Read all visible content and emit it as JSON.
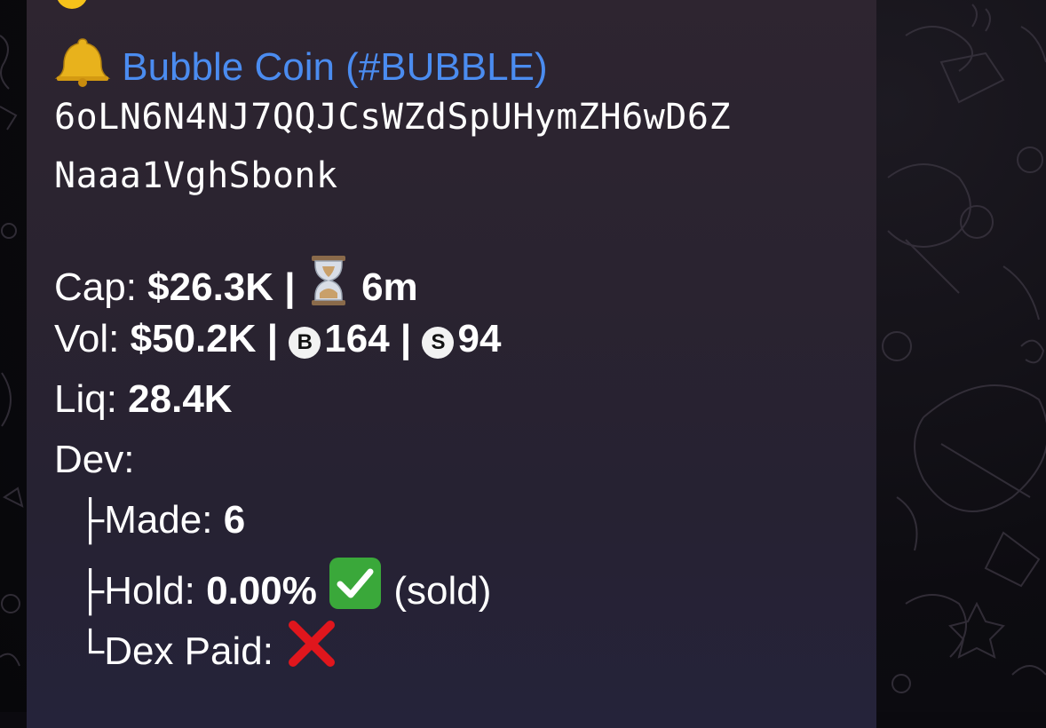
{
  "message": {
    "header_cutoff": "Bubble Coin",
    "token_line": "Bubble Coin (#BUBBLE)",
    "token_icon": "bell-icon",
    "address_line1": "6oLN6N4NJ7QQJCsWZdSpUHymZH6wD6Z",
    "address_line2": "Naaa1VghSbonk",
    "cap_label": "Cap: ",
    "cap_value": "$26.3K |",
    "age_icon": "hourglass-icon",
    "age_value": "6m",
    "vol_label": "Vol: ",
    "vol_value": "$50.2K |",
    "buys_icon_letter": "B",
    "buys_value": "164 |",
    "sells_icon_letter": "S",
    "sells_value": "94",
    "liq_label": "Liq: ",
    "liq_value": "28.4K",
    "dev_label": "Dev:",
    "made_prefix": "├",
    "made_label": "Made: ",
    "made_value": "6",
    "hold_prefix": "├",
    "hold_label": "Hold: ",
    "hold_value": "0.00%",
    "hold_status_icon": "check-mark-icon",
    "hold_note": "(sold)",
    "dex_prefix": "└",
    "dex_label": "Dex Paid: ",
    "dex_status_icon": "cross-mark-icon"
  },
  "colors": {
    "link": "#4b8cf0",
    "bubble": "#2a2330",
    "text": "#ffffff",
    "check_green": "#3aa83a",
    "cross_red": "#e0161d"
  }
}
